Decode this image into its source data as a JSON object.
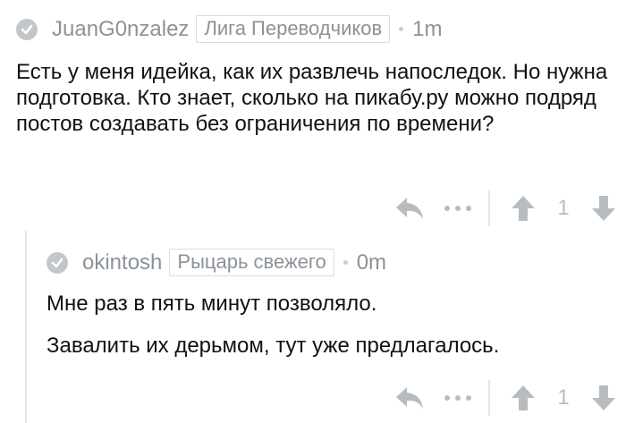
{
  "comments": [
    {
      "username": "JuanG0nzalez",
      "badge": "Лига Переводчиков",
      "time": "1m",
      "paragraphs": [
        "Есть у меня идейка, как их развлечь напоследок. Но нужна подготовка. Кто знает, сколько на пикабу.ру можно подряд постов создавать без ограничения по времени?"
      ],
      "rating": "1"
    },
    {
      "username": "okintosh",
      "badge": "Рыцарь свежего",
      "time": "0m",
      "paragraphs": [
        "Мне раз в пять минут позволяло.",
        "Завалить их дерьмом, тут уже предлагалось."
      ],
      "rating": "1"
    }
  ],
  "icons": {
    "avatar": "check-circle-icon",
    "reply": "reply-arrow-icon",
    "more": "more-dots-icon",
    "upvote": "arrow-up-icon",
    "downvote": "arrow-down-icon"
  },
  "colors": {
    "meta_text": "#8b9298",
    "icon_gray": "#b7bcc0",
    "body_text": "#111111"
  }
}
